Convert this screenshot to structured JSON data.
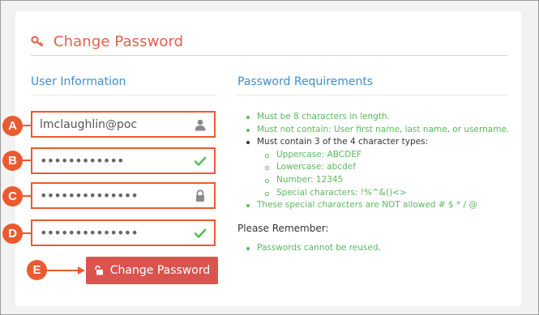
{
  "title": "Change Password",
  "user_info": {
    "heading": "User Information",
    "fields": [
      {
        "marker": "A",
        "value": "lmclaughlin@poc",
        "icon": "user-icon",
        "masked": false
      },
      {
        "marker": "B",
        "value": "••••••••••••",
        "icon": "check-icon",
        "masked": true
      },
      {
        "marker": "C",
        "value": "••••••••••••••",
        "icon": "lock-icon",
        "masked": true
      },
      {
        "marker": "D",
        "value": "••••••••••••••",
        "icon": "check-icon",
        "masked": true
      }
    ]
  },
  "button": {
    "marker": "E",
    "label": "Change Password",
    "icon": "unlock-icon"
  },
  "requirements": {
    "heading": "Password Requirements",
    "items": [
      "Must be 8 characters in length.",
      "Must not contain: User first name, last name, or username.",
      "Must contain 3 of the 4 character types:",
      "Uppercase: ABCDEF",
      "Lowercase: abcdef",
      "Number: 12345",
      "Special characters: !%^&()<>",
      "These special characters are NOT allowed # $ * / @"
    ]
  },
  "remember": {
    "heading": "Please Remember:",
    "items": [
      "Passwords cannot be reused."
    ]
  },
  "colors": {
    "accent": "#e0614a",
    "heading_blue": "#3d8ec9",
    "success_green": "#5cb85c",
    "annotation_orange": "#ea5a2f",
    "button_red": "#d9534f"
  }
}
